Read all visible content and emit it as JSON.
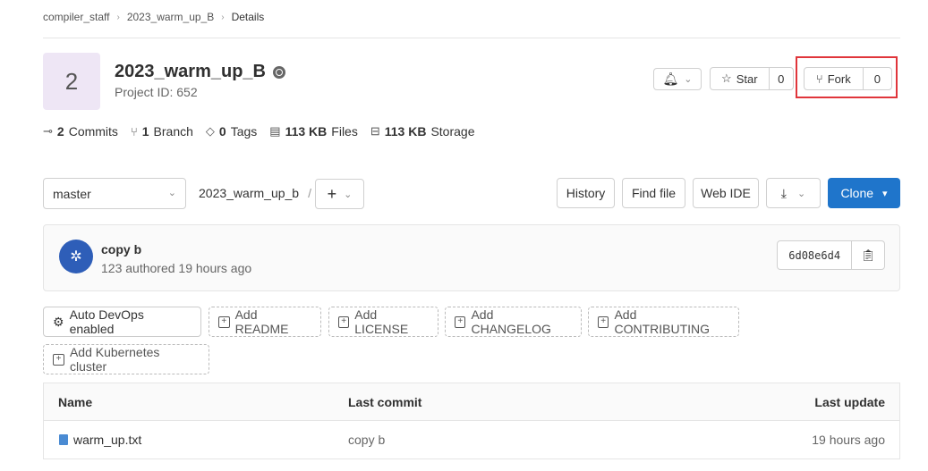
{
  "breadcrumb": {
    "items": [
      "compiler_staff",
      "2023_warm_up_B",
      "Details"
    ]
  },
  "project": {
    "avatar_letter": "2",
    "title": "2023_warm_up_B",
    "id_text": "Project ID: 652"
  },
  "actions": {
    "star_label": "Star",
    "star_count": "0",
    "fork_label": "Fork",
    "fork_count": "0"
  },
  "stats": [
    {
      "icon": "commit-icon",
      "count": "2",
      "label": "Commits"
    },
    {
      "icon": "branch-icon",
      "count": "1",
      "label": "Branch"
    },
    {
      "icon": "tag-icon",
      "count": "0",
      "label": "Tags"
    },
    {
      "icon": "file-icon",
      "count": "113 KB",
      "label": "Files"
    },
    {
      "icon": "storage-icon",
      "count": "113 KB",
      "label": "Storage"
    }
  ],
  "repo": {
    "branch": "master",
    "path": "2023_warm_up_b",
    "separator": "/"
  },
  "toolbar": {
    "history": "History",
    "find_file": "Find file",
    "web_ide": "Web IDE",
    "clone": "Clone"
  },
  "commit": {
    "message": "copy b",
    "meta": "123 authored 19 hours ago",
    "sha": "6d08e6d4"
  },
  "chips": {
    "auto_devops": "Auto DevOps enabled",
    "readme": "Add README",
    "license": "Add LICENSE",
    "changelog": "Add CHANGELOG",
    "contributing": "Add CONTRIBUTING",
    "kubernetes": "Add Kubernetes cluster"
  },
  "table": {
    "headers": {
      "name": "Name",
      "last_commit": "Last commit",
      "last_update": "Last update"
    },
    "rows": [
      {
        "name": "warm_up.txt",
        "last_commit": "copy b",
        "last_update": "19 hours ago"
      }
    ]
  },
  "colors": {
    "accent": "#1f75cb",
    "highlight": "#e0353b",
    "avatar_bg": "#eee6f5"
  }
}
